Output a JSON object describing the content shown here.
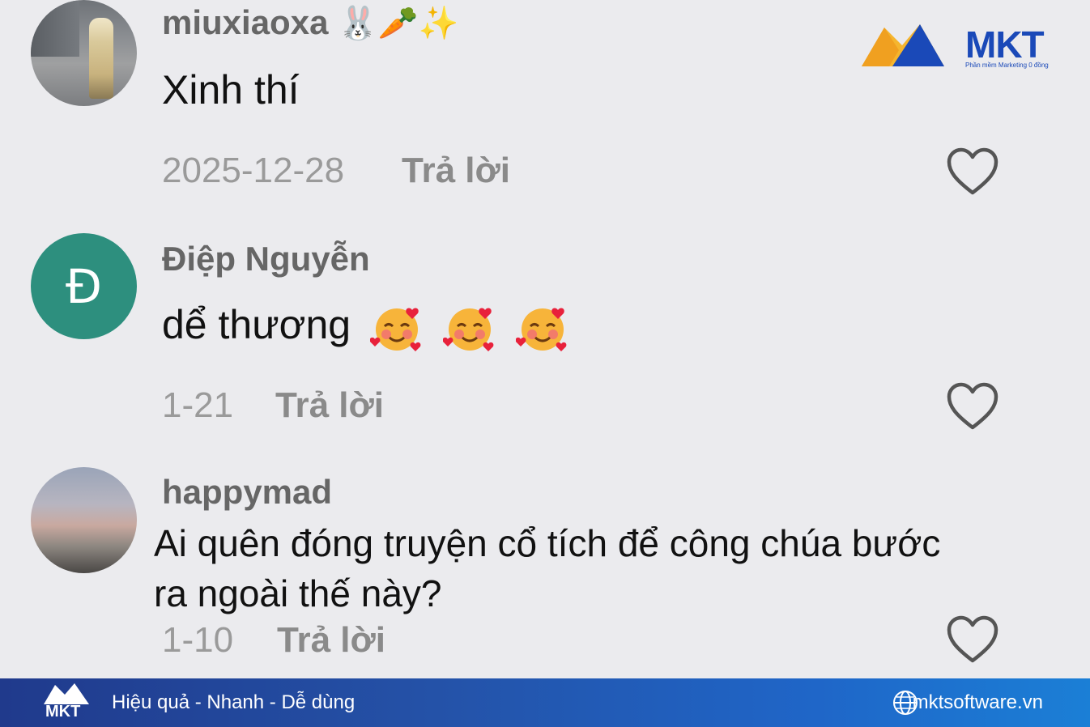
{
  "brand": {
    "logo_text": "MKT",
    "logo_tagline": "Phần mềm Marketing 0 đồng"
  },
  "comments": [
    {
      "username": "miuxiaoxa",
      "username_emoji": "🐰🥕✨",
      "text": "Xinh thí",
      "date": "2025-12-28",
      "reply_label": "Trả lời",
      "avatar": "photo"
    },
    {
      "username": "Điệp Nguyễn",
      "avatar_letter": "Đ",
      "text": "dể thương",
      "text_emoji": "smiling-face-with-hearts x3",
      "date": "1-21",
      "reply_label": "Trả lời",
      "avatar": "letter"
    },
    {
      "username": "happymad",
      "text_line1": "Ai quên đóng truyện cổ tích để công chúa bước",
      "text_line2": "ra ngoài thế này?",
      "date": "1-10",
      "reply_label": "Trả lời",
      "avatar": "photo"
    }
  ],
  "footer": {
    "slogan": "Hiệu quả - Nhanh - Dễ dùng",
    "website": "mktsoftware.vn"
  },
  "colors": {
    "background": "#ebebee",
    "avatar_letter_bg": "#2d8f7e",
    "brand_blue": "#1a49b8",
    "footer_start": "#203a8c",
    "footer_end": "#1b7fd6"
  }
}
